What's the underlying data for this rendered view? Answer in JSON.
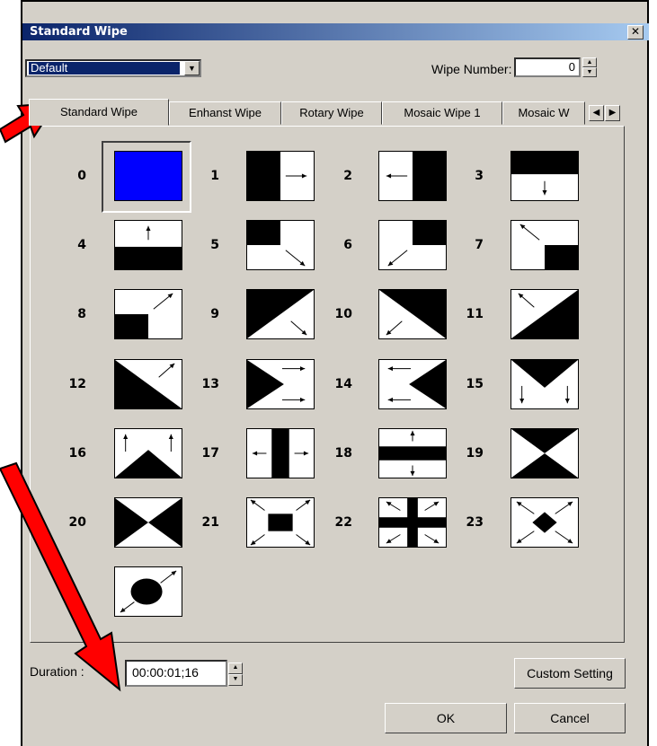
{
  "window": {
    "title": "Standard Wipe",
    "close_glyph": "✕"
  },
  "preset": {
    "selected": "Default"
  },
  "wipe_number": {
    "label": "Wipe Number:",
    "value": "0"
  },
  "tabs": [
    {
      "label": "Standard Wipe",
      "active": true
    },
    {
      "label": "Enhanst Wipe"
    },
    {
      "label": "Rotary Wipe"
    },
    {
      "label": "Mosaic Wipe 1"
    },
    {
      "label": "Mosaic W"
    }
  ],
  "wipes": [
    "0",
    "1",
    "2",
    "3",
    "4",
    "5",
    "6",
    "7",
    "8",
    "9",
    "10",
    "11",
    "12",
    "13",
    "14",
    "15",
    "16",
    "17",
    "18",
    "19",
    "20",
    "21",
    "22",
    "23",
    ""
  ],
  "duration": {
    "label": "Duration :",
    "value": "00:00:01;16"
  },
  "buttons": {
    "custom": "Custom Setting",
    "ok": "OK",
    "cancel": "Cancel"
  },
  "colors": {
    "selected_wipe": "#0000ff",
    "annotation_arrow": "#ff0000",
    "titlebar": "#0a246a"
  }
}
